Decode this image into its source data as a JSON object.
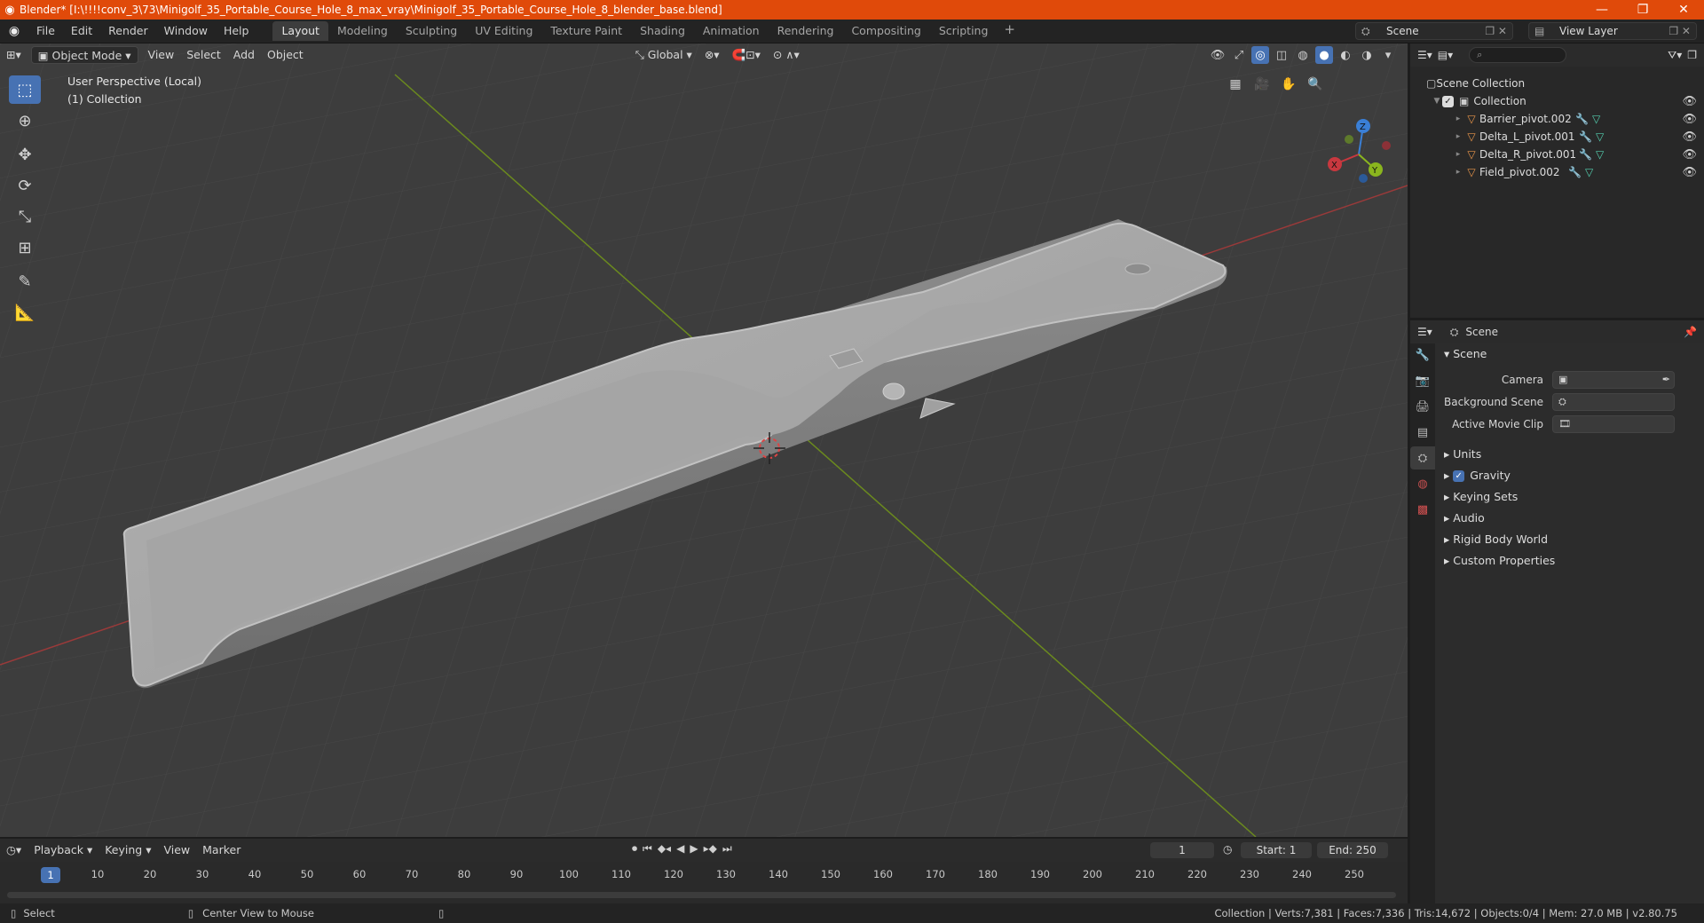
{
  "window": {
    "title": "Blender* [I:\\!!!!conv_3\\73\\Minigolf_35_Portable_Course_Hole_8_max_vray\\Minigolf_35_Portable_Course_Hole_8_blender_base.blend]",
    "minimize": "—",
    "maximize": "❐",
    "close": "✕"
  },
  "menu": [
    "File",
    "Edit",
    "Render",
    "Window",
    "Help"
  ],
  "workspaces": [
    "Layout",
    "Modeling",
    "Sculpting",
    "UV Editing",
    "Texture Paint",
    "Shading",
    "Animation",
    "Rendering",
    "Compositing",
    "Scripting"
  ],
  "active_workspace": "Layout",
  "scene_selector": "Scene",
  "view_layer_selector": "View Layer",
  "viewport": {
    "mode": "Object Mode",
    "menus": [
      "View",
      "Select",
      "Add",
      "Object"
    ],
    "transform_orientation": "Global",
    "perspective_label": "User Perspective (Local)",
    "collection_label": "(1) Collection",
    "gizmo": {
      "x": "X",
      "y": "Y",
      "z": "Z"
    }
  },
  "outliner": {
    "root": "Scene Collection",
    "collection": "Collection",
    "objects": [
      "Barrier_pivot.002",
      "Delta_L_pivot.001",
      "Delta_R_pivot.001",
      "Field_pivot.002"
    ]
  },
  "properties": {
    "header": "Scene",
    "panel": "Scene",
    "fields": [
      {
        "label": "Camera",
        "value": ""
      },
      {
        "label": "Background Scene",
        "value": ""
      },
      {
        "label": "Active Movie Clip",
        "value": ""
      }
    ],
    "subpanels": [
      "Units",
      "Gravity",
      "Keying Sets",
      "Audio",
      "Rigid Body World",
      "Custom Properties"
    ],
    "gravity_checked": true
  },
  "timeline": {
    "menus": [
      "Playback",
      "Keying",
      "View",
      "Marker"
    ],
    "current_frame": "1",
    "start_label": "Start:",
    "start": "1",
    "end_label": "End:",
    "end": "250",
    "ticks": [
      "10",
      "20",
      "30",
      "40",
      "50",
      "60",
      "70",
      "80",
      "90",
      "100",
      "110",
      "120",
      "130",
      "140",
      "150",
      "160",
      "170",
      "180",
      "190",
      "200",
      "210",
      "220",
      "230",
      "240",
      "250"
    ]
  },
  "statusbar": {
    "select": "Select",
    "center_view": "Center View to Mouse",
    "stats": "Collection | Verts:7,381 | Faces:7,336 | Tris:14,672 | Objects:0/4 | Mem: 27.0 MB | v2.80.75"
  },
  "colors": {
    "titlebar": "#e04a0a",
    "accent": "#4772b3",
    "viewport_bg": "#3d3d3d",
    "x_axis": "#c8383f",
    "y_axis": "#8ab51e",
    "z_axis": "#3a7fd6"
  }
}
